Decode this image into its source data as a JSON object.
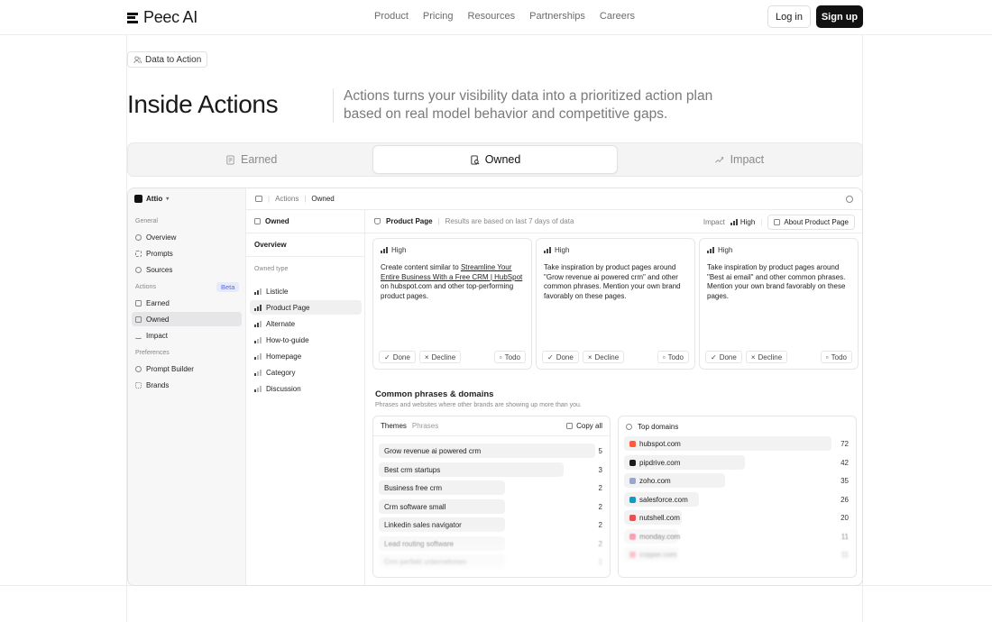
{
  "nav": {
    "brand": "Peec AI",
    "links": [
      "Product",
      "Pricing",
      "Resources",
      "Partnerships",
      "Careers"
    ],
    "login": "Log in",
    "signup": "Sign up"
  },
  "hero": {
    "chip": "Data to Action",
    "title": "Inside Actions",
    "description": "Actions turns your visibility data into a prioritized action plan based on real model behavior and competitive gaps."
  },
  "tabs": [
    {
      "label": "Earned",
      "icon": "document-icon"
    },
    {
      "label": "Owned",
      "icon": "document-search-icon"
    },
    {
      "label": "Impact",
      "icon": "trend-icon"
    }
  ],
  "app": {
    "workspace": "Attio",
    "sidebar": {
      "general_label": "General",
      "general": [
        "Overview",
        "Prompts",
        "Sources"
      ],
      "actions_label": "Actions",
      "beta": "Beta",
      "actions": [
        "Earned",
        "Owned",
        "Impact"
      ],
      "preferences_label": "Preferences",
      "preferences": [
        "Prompt Builder",
        "Brands"
      ]
    },
    "breadcrumb": [
      "Actions",
      "Owned"
    ],
    "subnav": {
      "head": "Owned",
      "overview": "Overview",
      "owned_type_label": "Owned type",
      "items": [
        "Listicle",
        "Product Page",
        "Alternate",
        "How-to-guide",
        "Homepage",
        "Category",
        "Discussion"
      ]
    },
    "main": {
      "page": "Product Page",
      "results_note": "Results are based on last 7 days of data",
      "impact_label": "Impact",
      "impact_value": "High",
      "about_button": "About Product Page",
      "cards": [
        {
          "priority": "High",
          "pre": "Create content similar to ",
          "link": "Streamline Your Entire Business With a Free CRM | HubSpot",
          "post": " on hubspot.com and other top-performing product pages."
        },
        {
          "priority": "High",
          "pre": "Take inspiration by product pages around \"Grow revenue ai powered crm\" and other common phrases. Mention your own brand favorably on these pages.",
          "link": "",
          "post": ""
        },
        {
          "priority": "High",
          "pre": "Take inspiration by product pages around \"Best ai email\" and other common phrases. Mention your own brand favorably on these pages.",
          "link": "",
          "post": ""
        }
      ],
      "card_actions": {
        "done": "Done",
        "decline": "Decline",
        "todo": "Todo"
      },
      "common_title": "Common phrases & domains",
      "common_sub": "Phrases and websites where other brands are showing up more than you.",
      "themes_tab": "Themes",
      "phrases_tab": "Phrases",
      "copy_all": "Copy all",
      "phrases": [
        {
          "label": "Grow revenue ai powered crm",
          "value": 5
        },
        {
          "label": "Best crm startups",
          "value": 3
        },
        {
          "label": "Business free crm",
          "value": 2
        },
        {
          "label": "Crm software small",
          "value": 2
        },
        {
          "label": "Linkedin sales navigator",
          "value": 2
        },
        {
          "label": "Lead routing software",
          "value": 2
        },
        {
          "label": "Crm perfekt unternehmen",
          "value": 1
        }
      ],
      "top_domains": "Top domains",
      "domains": [
        {
          "label": "hubspot.com",
          "value": 72,
          "color": "#ff5c35"
        },
        {
          "label": "pipdrive.com",
          "value": 42,
          "color": "#1a1a1a"
        },
        {
          "label": "zoho.com",
          "value": 35,
          "color": "#9aa7c7"
        },
        {
          "label": "salesforce.com",
          "value": 26,
          "color": "#1798c1"
        },
        {
          "label": "nutshell.com",
          "value": 20,
          "color": "#f04e4e"
        },
        {
          "label": "monday.com",
          "value": 11,
          "color": "#f0546e"
        },
        {
          "label": "copper.com",
          "value": 11,
          "color": "#f0546e"
        }
      ]
    }
  }
}
